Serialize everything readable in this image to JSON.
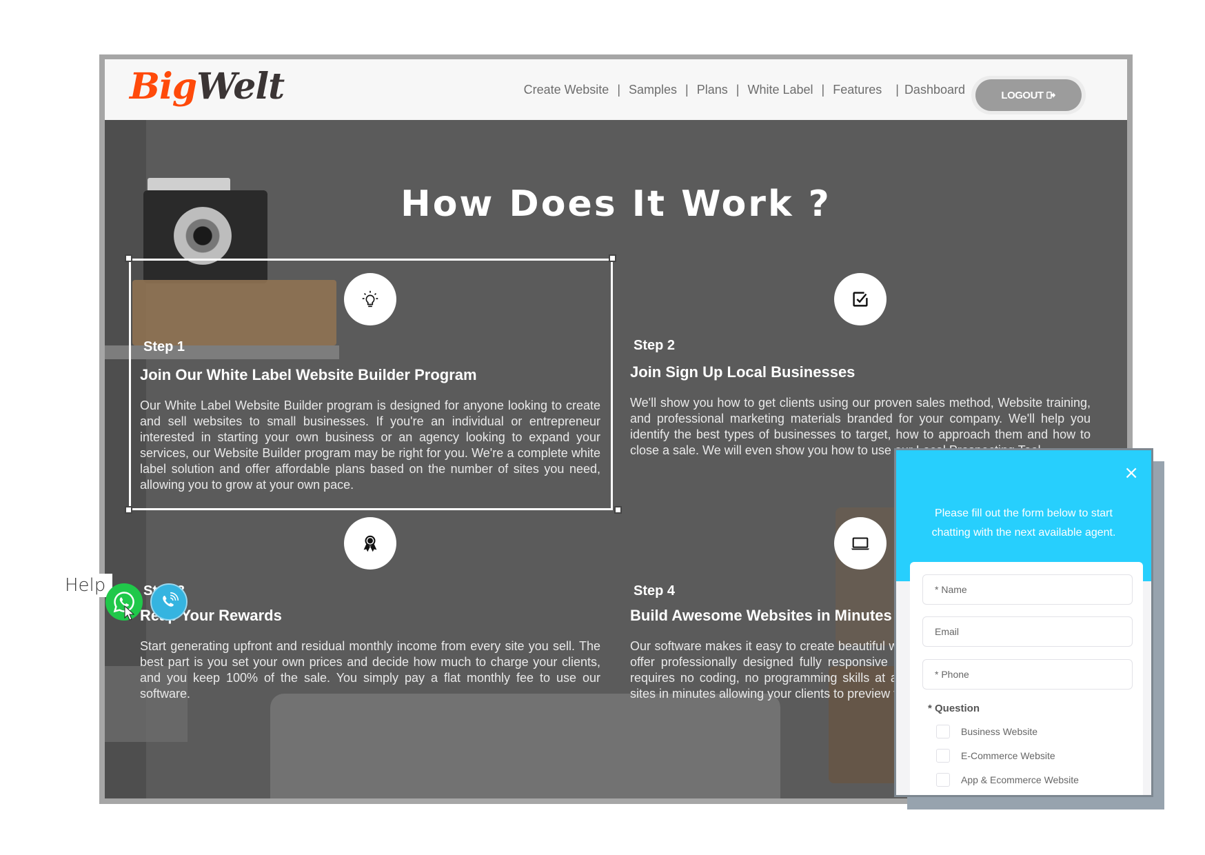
{
  "header": {
    "logo_part1": "Big",
    "logo_part2": "Welt",
    "nav": [
      {
        "label": "Create Website"
      },
      {
        "label": "Samples"
      },
      {
        "label": "Plans"
      },
      {
        "label": "White Label"
      },
      {
        "label": "Features"
      },
      {
        "label": "Dashboard"
      }
    ],
    "separator": "|",
    "logout_label": "LOGOUT",
    "logout_icon": "sign-out-icon"
  },
  "main": {
    "title": "How Does It Work ?",
    "steps": [
      {
        "label": "Step 1",
        "heading": "Join Our White Label Website Builder Program",
        "icon": "lightbulb-icon",
        "description": "Our White Label Website Builder program is designed for anyone looking to create and sell websites to small businesses. If you're an individual or entrepreneur interested in starting your own business or an agency looking to expand your services, our Website Builder program may be right for you. We're a complete white label solution and offer affordable plans based on the number of sites you need, allowing you to grow at your own pace."
      },
      {
        "label": "Step 2",
        "heading": "Join Sign Up Local Businesses",
        "icon": "checkbox-icon",
        "description": "We'll show you how to get clients using our proven sales method, Website training, and professional marketing materials branded for your company. We'll help you identify the best types of businesses to target, how to approach them and how to close a sale. We will even show you how to use our Local Prospecting Tool."
      },
      {
        "label": "Step 3",
        "heading": "Reap Your Rewards",
        "icon": "award-ribbon-icon",
        "description": "Start generating upfront and residual monthly income from every site you sell. The best part is you set your own prices and decide how much to charge your clients, and you keep 100% of the sale. You simply pay a flat monthly fee to use our software."
      },
      {
        "label": "Step 4",
        "heading": "Build Awesome Websites in Minutes",
        "icon": "laptop-icon",
        "description": "Our software makes it easy to create beautiful websites for any small business. We offer professionally designed fully responsive templates and our website builder requires no coding, no programming skills at all. You can even create live demo sites in minutes allowing your clients to preview their site before they buy."
      }
    ]
  },
  "help": {
    "label": "Help",
    "whatsapp_icon": "whatsapp-icon",
    "phone_icon": "phone-call-icon"
  },
  "chat": {
    "close_label": "×",
    "intro_line1": "Please fill out the form below to start",
    "intro_line2": "chatting with the next available agent.",
    "fields": {
      "name_placeholder": "* Name",
      "email_placeholder": "Email",
      "phone_placeholder": "* Phone"
    },
    "question_label": "* Question",
    "options": [
      {
        "label": "Business Website",
        "checked": false
      },
      {
        "label": "E-Commerce Website",
        "checked": false
      },
      {
        "label": "App & Ecommerce Website",
        "checked": false
      }
    ]
  },
  "colors": {
    "brand_orange": "#ff4a0a",
    "chat_accent": "#27cffd",
    "whatsapp_green": "#20c84a"
  }
}
